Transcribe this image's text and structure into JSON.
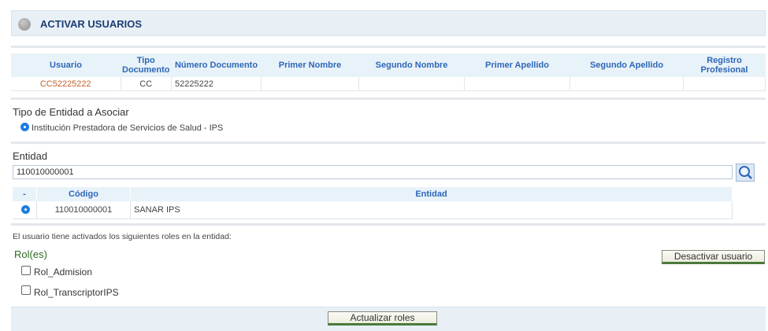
{
  "header": {
    "title": "ACTIVAR USUARIOS"
  },
  "users_table": {
    "columns": [
      "Usuario",
      "Tipo Documento",
      "Número Documento",
      "Primer Nombre",
      "Segundo Nombre",
      "Primer Apellido",
      "Segundo Apellido",
      "Registro Profesional"
    ],
    "row": {
      "usuario": "CC52225222",
      "tipo": "CC",
      "numero": "52225222",
      "primer_nombre": "",
      "segundo_nombre": "",
      "primer_apellido": "",
      "segundo_apellido": "",
      "registro": ""
    }
  },
  "tipo_entidad": {
    "label": "Tipo de Entidad a Asociar",
    "option": "Institución Prestadora de Servicios de Salud - IPS"
  },
  "entidad": {
    "label": "Entidad",
    "value": "110010000001",
    "columns": [
      "-",
      "Código",
      "Entidad"
    ],
    "row": {
      "codigo": "110010000001",
      "entidad": "SANAR IPS"
    }
  },
  "roles": {
    "info": "El usuario tiene activados los siguientes roles en la entidad:",
    "label": "Rol(es)",
    "items": [
      "Rol_Admision",
      "Rol_TranscriptorIPS"
    ],
    "deactivate_button": "Desactivar usuario",
    "update_button": "Actualizar roles"
  },
  "colors": {
    "header_text": "#1d3d73",
    "column_text": "#2e67b8",
    "link_text": "#c0622a",
    "radio": "#1e7ee0",
    "button_underline": "#4a7a3c"
  }
}
